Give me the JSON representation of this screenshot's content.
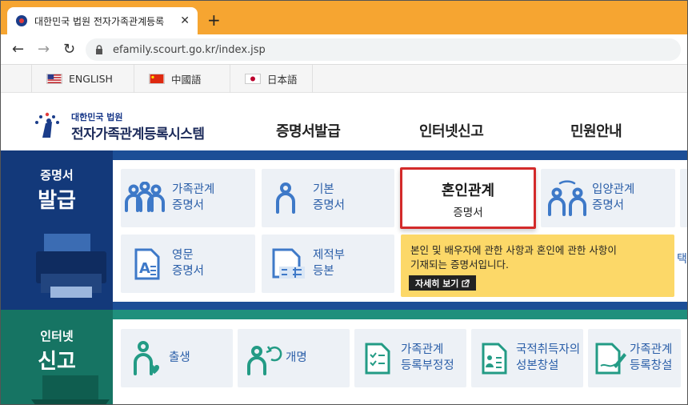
{
  "browser": {
    "tab_title": "대한민국 법원 전자가족관계등록",
    "close_glyph": "✕",
    "newtab_glyph": "+",
    "url": "efamily.scourt.go.kr/index.jsp",
    "back_glyph": "←",
    "forward_glyph": "→",
    "reload_glyph": "↻"
  },
  "languages": [
    {
      "label": "ENGLISH",
      "flag": "us-flag-icon"
    },
    {
      "label": "中國語",
      "flag": "cn-flag-icon"
    },
    {
      "label": "日本語",
      "flag": "jp-flag-icon"
    }
  ],
  "header": {
    "logo_small": "대한민국 법원",
    "logo_big": "전자가족관계등록시스템",
    "menu": [
      "증명서발급",
      "인터넷신고",
      "민원안내"
    ]
  },
  "cert": {
    "side_sub": "증명서",
    "side_main": "발급",
    "cards": [
      {
        "line1": "가족관계",
        "line2": "증명서",
        "icon": "family-icon"
      },
      {
        "line1": "기본",
        "line2": "증명서",
        "icon": "person-icon"
      },
      {
        "line1": "혼인관계",
        "line2": "증명서",
        "icon": "marriage-icon"
      },
      {
        "line1": "입양관계",
        "line2": "증명서",
        "icon": "adoption-icon"
      },
      {
        "line1": "영문",
        "line2": "증명서",
        "icon": "english-doc-icon"
      },
      {
        "line1": "제적부",
        "line2": "등본",
        "icon": "removed-register-icon"
      }
    ],
    "tooltip": {
      "line1": "본인 및 배우자에 관한 사항과 혼인에 관한 사항이",
      "line2": "기재되는 증명서입니다.",
      "more": "자세히 보기"
    },
    "partial_label": "택"
  },
  "report": {
    "side_sub": "인터넷",
    "side_main": "신고",
    "cards": [
      {
        "line1": "출생",
        "line2": "",
        "icon": "birth-icon"
      },
      {
        "line1": "개명",
        "line2": "",
        "icon": "rename-icon"
      },
      {
        "line1": "가족관계",
        "line2": "등록부정정",
        "icon": "correction-icon"
      },
      {
        "line1": "국적취득자의",
        "line2": "성본창설",
        "icon": "naturalization-icon"
      },
      {
        "line1": "가족관계",
        "line2": "등록창설",
        "icon": "registration-create-icon"
      }
    ]
  },
  "colors": {
    "tabbar": "#f6a531",
    "cert_band": "#1c4e96",
    "report_band": "#1f8f7c",
    "selected_border": "#d32a2a",
    "tooltip": "#fcd868"
  }
}
